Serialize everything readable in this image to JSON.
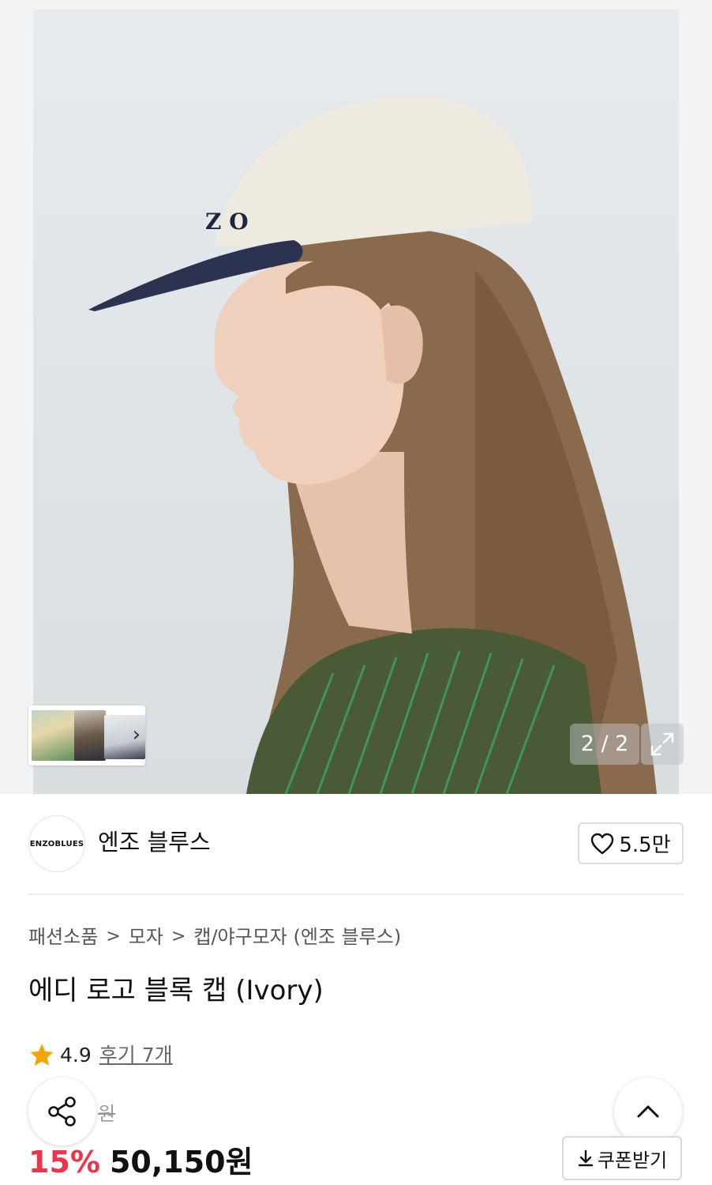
{
  "gallery": {
    "counter": "2 / 2",
    "thumbnails": [
      "thumbnail-1",
      "thumbnail-2",
      "thumbnail-3"
    ]
  },
  "brand": {
    "logo_text": "ENZOBLUES",
    "name": "엔조 블루스"
  },
  "like": {
    "count": "5.5만"
  },
  "breadcrumb": {
    "items": [
      "패션소품",
      "모자",
      "캡/야구모자 (엔조 블루스)"
    ],
    "separator": ">"
  },
  "product": {
    "title": "에디 로고 블록 캡 (Ivory)"
  },
  "rating": {
    "score": "4.9",
    "reviews": "후기 7개"
  },
  "price": {
    "original_visible": "원",
    "discount": "15%",
    "sale": "50,150원"
  },
  "actions": {
    "coupon_label": "쿠폰받기"
  },
  "colors": {
    "discount_red": "#f0334a",
    "star": "#f7a400"
  }
}
